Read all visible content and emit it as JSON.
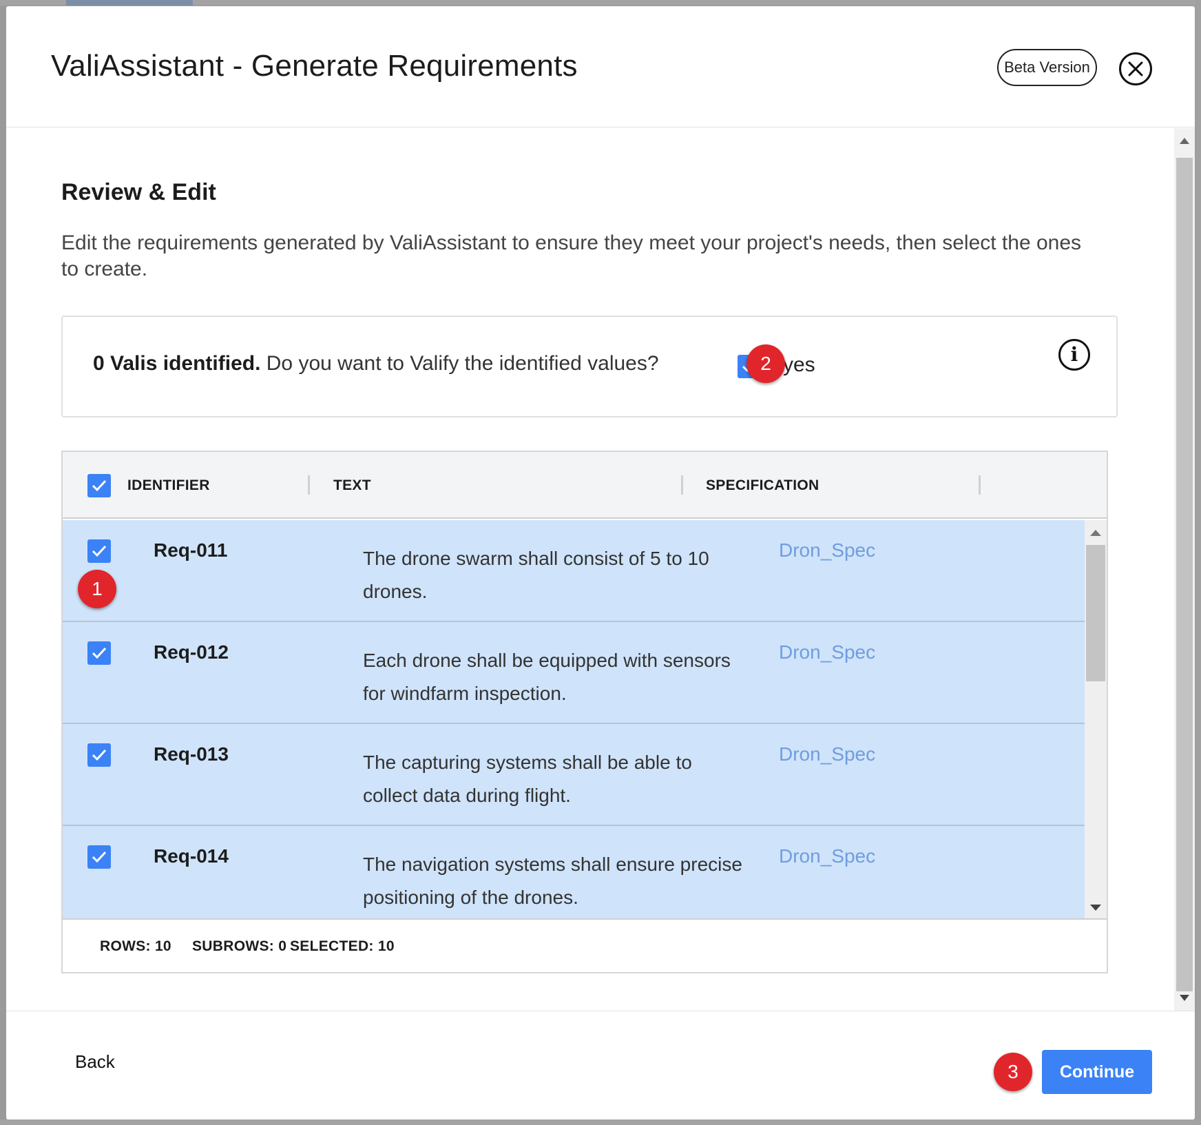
{
  "dialog": {
    "title": "ValiAssistant - Generate Requirements",
    "beta_label": "Beta Version"
  },
  "review": {
    "title": "Review & Edit",
    "description": "Edit the requirements generated by ValiAssistant to ensure they meet your project's needs, then select the ones to create."
  },
  "valify": {
    "count_label": "0 Valis identified.",
    "question": "Do you want to Valify the identified values?",
    "checked": true,
    "yes_label": "yes"
  },
  "table": {
    "columns": [
      "IDENTIFIER",
      "TEXT",
      "SPECIFICATION"
    ],
    "rows": [
      {
        "id": "Req-011",
        "text": "The drone swarm shall consist of 5 to 10 drones.",
        "spec": "Dron_Spec",
        "checked": true
      },
      {
        "id": "Req-012",
        "text": "Each drone shall be equipped with sensors for windfarm inspection.",
        "spec": "Dron_Spec",
        "checked": true
      },
      {
        "id": "Req-013",
        "text": "The capturing systems shall be able to collect data during flight.",
        "spec": "Dron_Spec",
        "checked": true
      },
      {
        "id": "Req-014",
        "text": "The navigation systems shall ensure precise positioning of the drones.",
        "spec": "Dron_Spec",
        "checked": true
      }
    ],
    "footer": {
      "rows_label": "ROWS:  10",
      "subrows_label": "SUBROWS:  0",
      "selected_label": "SELECTED: 10"
    }
  },
  "annotations": [
    "1",
    "2",
    "3"
  ],
  "footer": {
    "back_label": "Back",
    "continue_label": "Continue"
  },
  "colors": {
    "accent": "#3b82f6",
    "row_selected": "#cfe3fa",
    "badge": "#e0262b",
    "link": "#6f9de0"
  },
  "icons": {
    "close": "close-circle-icon",
    "info": "info-icon",
    "check": "checkmark-icon"
  }
}
